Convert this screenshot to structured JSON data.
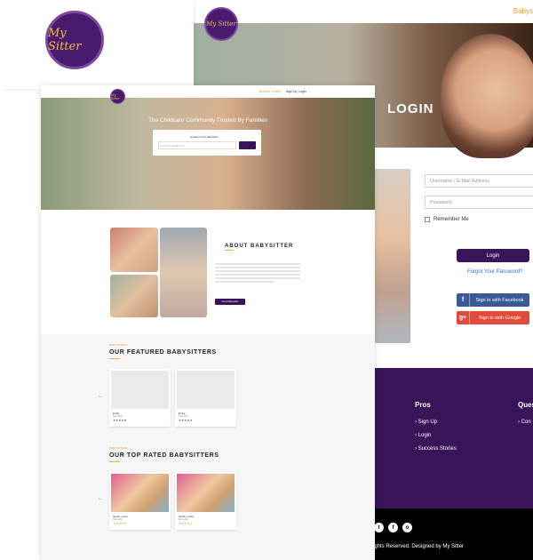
{
  "brand": {
    "logo_text": "My Sitter",
    "primary_color": "#3a1458",
    "accent_color": "#f0b040"
  },
  "login_page": {
    "top_link": "Babys",
    "title": "LOGIN",
    "username_placeholder": "Username / E-Mail Address",
    "password_placeholder": "Password",
    "remember_label": "Remember Me",
    "login_button": "Login",
    "forgot_link": "Forgot Your Password?",
    "facebook_button": "Sign in with Facebook",
    "google_button": "Sign in with Google",
    "facebook_icon": "f",
    "google_icon": "g+",
    "footer": {
      "pros_heading": "Pros",
      "pros_links": [
        "Sign Up",
        "Login",
        "Success Stories"
      ],
      "questions_heading": "Ques",
      "questions_link": "Con",
      "social_icons": [
        "G",
        "t",
        "f",
        "o"
      ],
      "copyright": "ights Reserved. Designed by My Sitter"
    }
  },
  "home_page": {
    "nav": {
      "link1": "Become a sitter",
      "link2": "Sign Up",
      "link3": "Login"
    },
    "hero_title": "The Childcare Community Trusted By Families",
    "search_label": "Quickly find a babysitter",
    "search_placeholder": "Enter postcode here",
    "about": {
      "title": "ABOUT BABYSITTER",
      "button": "Find a Babysitter"
    },
    "featured": {
      "kicker": "BABYSITTERS",
      "title": "OUR FEATURED BABYSITTERS",
      "cards": [
        {
          "name": "Emily",
          "sub": "Babysitter",
          "stars": "★★★★★"
        },
        {
          "name": "Emily",
          "sub": "Babysitter",
          "stars": "★★★★★"
        }
      ]
    },
    "top_rated": {
      "kicker": "BABYSITTERS",
      "title": "OUR TOP RATED BABYSITTERS",
      "cards": [
        {
          "name": "Sarah_Lowe",
          "sub": "Babysitter",
          "stars": "★★★★★"
        },
        {
          "name": "Sarah_Lowe",
          "sub": "Babysitter",
          "stars": "★★★★★"
        }
      ]
    },
    "arrow_left": "←"
  }
}
